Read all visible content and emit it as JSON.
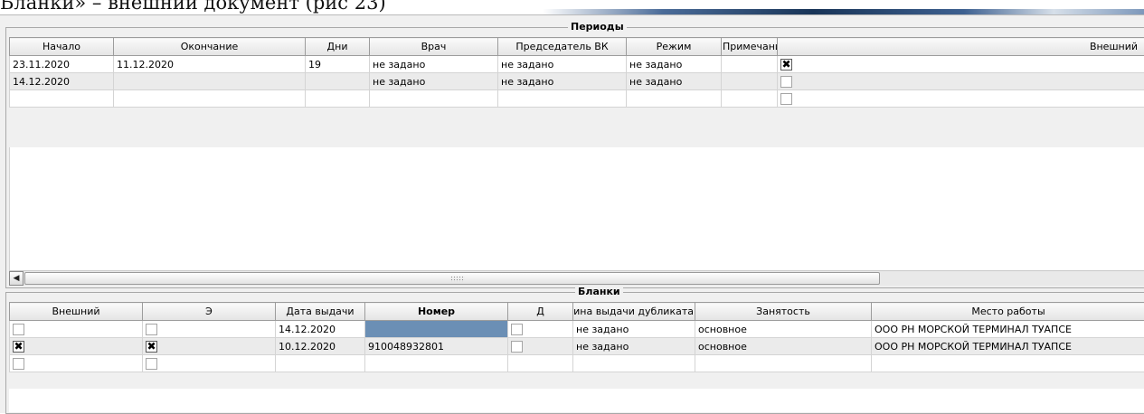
{
  "document": {
    "caption": "Бланки» – внешний документ (рис 23)"
  },
  "periods": {
    "title": "Периоды",
    "columns": [
      "Начало",
      "Окончание",
      "Дни",
      "Врач",
      "Председатель ВК",
      "Режим",
      "Примечание",
      "Внешний"
    ],
    "rows": [
      {
        "start": "23.11.2020",
        "end": "11.12.2020",
        "days": "19",
        "doctor": "не задано",
        "chairman": "не задано",
        "mode": "не задано",
        "note": "",
        "external": true
      },
      {
        "start": "14.12.2020",
        "end": "",
        "days": "",
        "doctor": "не задано",
        "chairman": "не задано",
        "mode": "не задано",
        "note": "",
        "external": false
      },
      {
        "start": "",
        "end": "",
        "days": "",
        "doctor": "",
        "chairman": "",
        "mode": "",
        "note": "",
        "external": false
      }
    ]
  },
  "blanks": {
    "title": "Бланки",
    "columns": [
      "Внешний",
      "Э",
      "Дата выдачи",
      "Номер",
      "Д",
      "Причина выдачи дубликата",
      "Занятость",
      "Место работы"
    ],
    "rows": [
      {
        "external": false,
        "e": false,
        "issue_date": "14.12.2020",
        "number": "",
        "d": false,
        "duplicate_reason": "не задано",
        "employment": "основное",
        "workplace": "ООО РН МОРСКОЙ ТЕРМИНАЛ ТУАПСЕ"
      },
      {
        "external": true,
        "e": true,
        "issue_date": "10.12.2020",
        "number": "910048932801",
        "d": false,
        "duplicate_reason": "не задано",
        "employment": "основное",
        "workplace": "ООО РН МОРСКОЙ ТЕРМИНАЛ ТУАПСЕ"
      },
      {
        "external": false,
        "e": false,
        "issue_date": "",
        "number": "",
        "d": false,
        "duplicate_reason": "",
        "employment": "",
        "workplace": ""
      }
    ]
  },
  "colors": {
    "selected_cell": "#6b8fb5",
    "header_bg": "#e4e4e4",
    "window_bg": "#f0f0f0"
  },
  "icons": {
    "checked": "✖",
    "scroll_left": "◀"
  }
}
